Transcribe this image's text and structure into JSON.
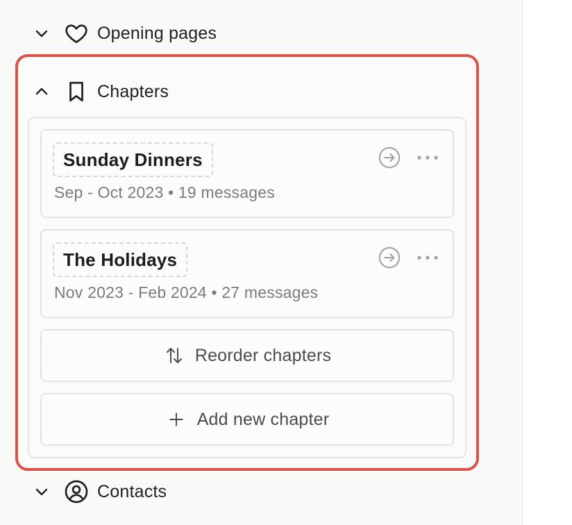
{
  "sections": {
    "opening_pages": {
      "label": "Opening pages",
      "expanded": false,
      "icon": "heart-icon"
    },
    "chapters": {
      "label": "Chapters",
      "expanded": true,
      "icon": "bookmark-icon"
    },
    "contacts": {
      "label": "Contacts",
      "expanded": false,
      "icon": "user-circle-icon"
    }
  },
  "chapters": [
    {
      "title": "Sunday Dinners",
      "meta": "Sep - Oct 2023 • 19 messages"
    },
    {
      "title": "The Holidays",
      "meta": "Nov 2023 - Feb 2024 • 27 messages"
    }
  ],
  "actions": {
    "reorder_label": "Reorder chapters",
    "add_label": "Add new chapter"
  },
  "colors": {
    "focus_ring": "#d9534a",
    "background": "#f9f9f7",
    "card_border": "#e3e3e0",
    "meta_text": "#7a7a77",
    "icon_muted": "#a3a3a0"
  }
}
